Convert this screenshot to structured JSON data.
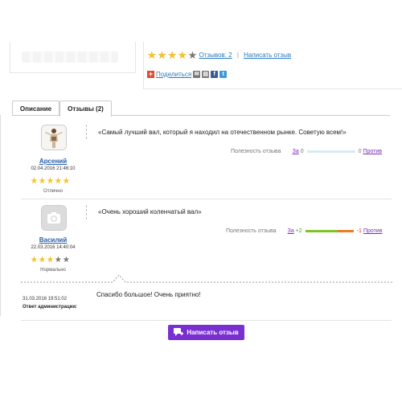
{
  "product": {
    "rating_stars": [
      true,
      true,
      true,
      true,
      false
    ],
    "reviews_link": "Отзывов: 2",
    "write_link": "Написать отзыв",
    "share_label": "Поделиться"
  },
  "tabs": [
    {
      "label": "Описание",
      "active": false
    },
    {
      "label": "Отзывы (2)",
      "active": true
    }
  ],
  "reviews": [
    {
      "author": "Арсений",
      "date": "02.04.2016 21:46:10",
      "stars": [
        true,
        true,
        true,
        true,
        true
      ],
      "verdict": "Отлично",
      "text": "«Самый лучший вал, который я находил на отечественном рынке. Советую всем!»",
      "usefulness_label": "Полезность отзыва",
      "for_label": "За",
      "for_count": "0",
      "against_count": "0",
      "against_label": "Против",
      "usefulness_fraction": 0
    },
    {
      "author": "Василий",
      "date": "22.03.2016 14:40:04",
      "stars": [
        true,
        true,
        true,
        false,
        false
      ],
      "verdict": "Нормально",
      "text": "«Очень хороший коленчатый вал»",
      "usefulness_label": "Полезность отзыва",
      "for_label": "За",
      "for_count": "+2",
      "against_count": "-1",
      "against_label": "Против",
      "usefulness_fraction": 0.67
    }
  ],
  "admin_reply": {
    "date": "31.03.2016 19:51:02",
    "label": "Ответ администрации:",
    "text": "Спасибо большое! Очень приятно!"
  },
  "write_button": "Написать отзыв",
  "colors": {
    "accent": "#7a2fd0",
    "link": "#2a7bbd",
    "star": "#f3c431",
    "positive": "#7fc323",
    "negative": "#f07a22"
  }
}
